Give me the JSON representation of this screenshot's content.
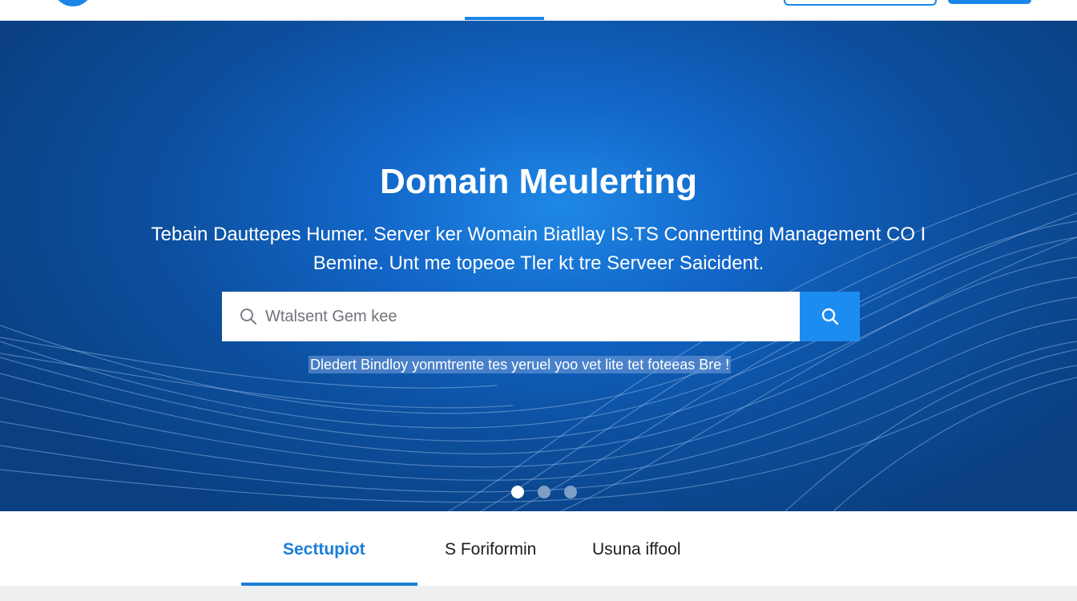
{
  "hero": {
    "title": "Domain Meulerting",
    "subtitle_line1": "Tebain Dauttepes Humer. Server ker Womain Biatllay IS.TS Connertting Management CO I",
    "subtitle_line2": "Bemine. Unt me topeoe Tler kt tre Serveer Saicident.",
    "hint": "Dledert Bindloy yonmtrente tes yeruel yoo vet lite tet foteeas Bre !"
  },
  "search": {
    "placeholder": "Wtalsent Gem kee",
    "icon": "search-icon"
  },
  "carousel": {
    "slide_count": 3,
    "active_index": 0
  },
  "tabs": [
    {
      "label": "Secttupiot",
      "active": true
    },
    {
      "label": "S Foriformin",
      "active": false
    },
    {
      "label": "Usuna iffool",
      "active": false
    }
  ],
  "colors": {
    "accent": "#1a86e8",
    "hero_dark": "#0a3f80",
    "hero_light": "#1f88e6",
    "search_button": "#1c8cf0"
  }
}
